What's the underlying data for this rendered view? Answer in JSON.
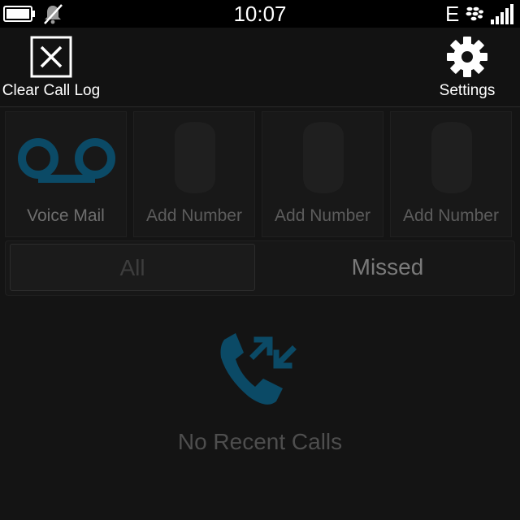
{
  "status_bar": {
    "time": "10:07",
    "network": "E",
    "icons": [
      "battery-icon",
      "muted-bell-icon",
      "blackberry-icon",
      "signal-bars-icon"
    ]
  },
  "action_bar": {
    "clear_label": "Clear Call Log",
    "clear_icon": "close-box-icon",
    "settings_label": "Settings",
    "settings_icon": "gear-icon"
  },
  "speed_dial": [
    {
      "label": "Voice Mail",
      "icon": "voicemail-icon"
    },
    {
      "label": "Add Number",
      "icon": "contact-silhouette-icon"
    },
    {
      "label": "Add Number",
      "icon": "contact-silhouette-icon"
    },
    {
      "label": "Add Number",
      "icon": "contact-silhouette-icon"
    }
  ],
  "filter": {
    "tabs": [
      "All",
      "Missed"
    ],
    "selected": "All"
  },
  "empty_state": {
    "icon": "recent-calls-icon",
    "message": "No Recent Calls"
  },
  "colors": {
    "background": "#141414",
    "status_bar": "#000000",
    "accent": "#0b4a66"
  }
}
